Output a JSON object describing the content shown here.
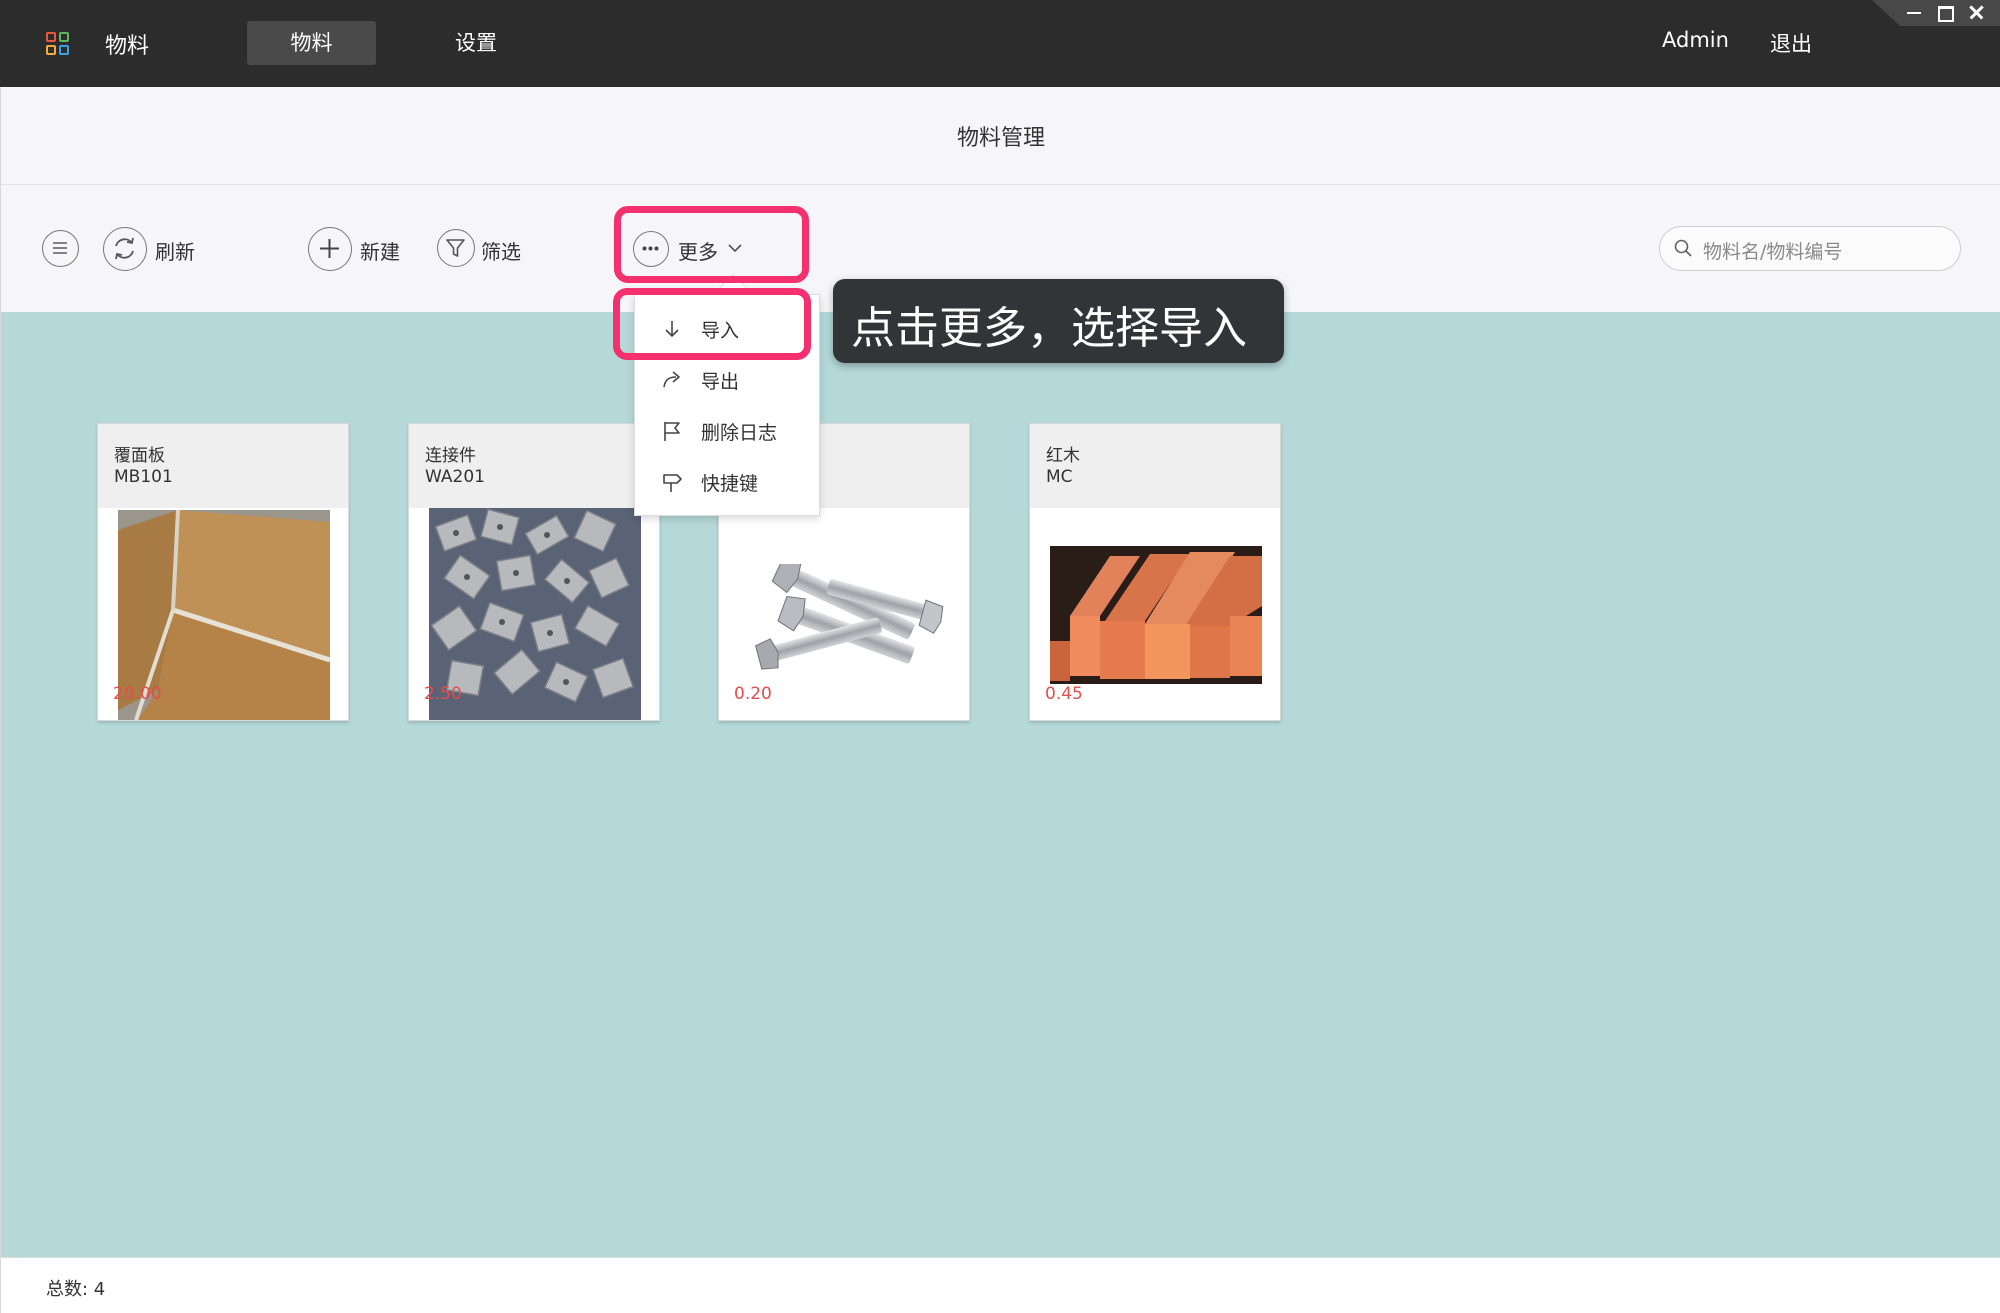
{
  "topbar": {
    "app_title": "物料",
    "tabs": [
      {
        "label": "物料",
        "active": true
      },
      {
        "label": "设置",
        "active": false
      }
    ],
    "user": "Admin",
    "logout": "退出"
  },
  "header": {
    "title": "物料管理"
  },
  "toolbar": {
    "refresh": "刷新",
    "new": "新建",
    "filter": "筛选",
    "more": "更多",
    "search_placeholder": "物料名/物料编号"
  },
  "dropdown": {
    "items": [
      {
        "label": "导入",
        "icon": "arrow-down-icon"
      },
      {
        "label": "导出",
        "icon": "share-icon"
      },
      {
        "label": "删除日志",
        "icon": "flag-icon"
      },
      {
        "label": "快捷键",
        "icon": "signpost-icon"
      }
    ]
  },
  "cards": [
    {
      "name": "覆面板",
      "code": "MB101",
      "price": "20.00",
      "image": "wood-panel-photo"
    },
    {
      "name": "连接件",
      "code": "WA201",
      "price": "2.50",
      "image": "metal-connectors-photo"
    },
    {
      "name": "",
      "code": "",
      "price": "0.20",
      "image": "bolts-photo"
    },
    {
      "name": "红木",
      "code": "MC",
      "price": "0.45",
      "image": "redwood-lumber-photo"
    }
  ],
  "footer": {
    "total_label": "总数: 4"
  },
  "annotation": {
    "text": "点击更多，选择导入"
  },
  "colors": {
    "topbar_bg": "#2c2c2c",
    "content_bg": "#b5d9d9",
    "price_red": "#e14e4e",
    "highlight_pink": "#f5306f",
    "tooltip_bg": "#313538"
  }
}
